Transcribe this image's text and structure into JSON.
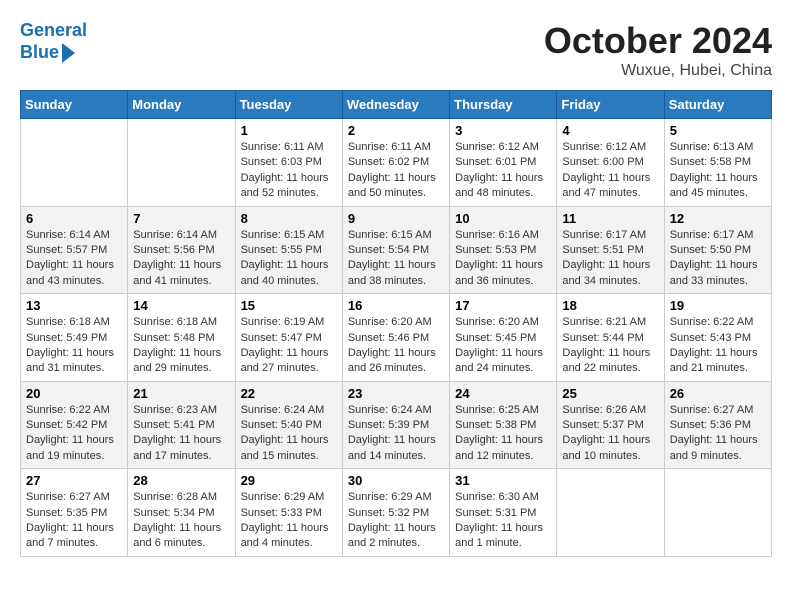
{
  "header": {
    "logo_line1": "General",
    "logo_line2": "Blue",
    "month": "October 2024",
    "location": "Wuxue, Hubei, China"
  },
  "weekdays": [
    "Sunday",
    "Monday",
    "Tuesday",
    "Wednesday",
    "Thursday",
    "Friday",
    "Saturday"
  ],
  "weeks": [
    [
      {
        "day": "",
        "info": ""
      },
      {
        "day": "",
        "info": ""
      },
      {
        "day": "1",
        "info": "Sunrise: 6:11 AM\nSunset: 6:03 PM\nDaylight: 11 hours and 52 minutes."
      },
      {
        "day": "2",
        "info": "Sunrise: 6:11 AM\nSunset: 6:02 PM\nDaylight: 11 hours and 50 minutes."
      },
      {
        "day": "3",
        "info": "Sunrise: 6:12 AM\nSunset: 6:01 PM\nDaylight: 11 hours and 48 minutes."
      },
      {
        "day": "4",
        "info": "Sunrise: 6:12 AM\nSunset: 6:00 PM\nDaylight: 11 hours and 47 minutes."
      },
      {
        "day": "5",
        "info": "Sunrise: 6:13 AM\nSunset: 5:58 PM\nDaylight: 11 hours and 45 minutes."
      }
    ],
    [
      {
        "day": "6",
        "info": "Sunrise: 6:14 AM\nSunset: 5:57 PM\nDaylight: 11 hours and 43 minutes."
      },
      {
        "day": "7",
        "info": "Sunrise: 6:14 AM\nSunset: 5:56 PM\nDaylight: 11 hours and 41 minutes."
      },
      {
        "day": "8",
        "info": "Sunrise: 6:15 AM\nSunset: 5:55 PM\nDaylight: 11 hours and 40 minutes."
      },
      {
        "day": "9",
        "info": "Sunrise: 6:15 AM\nSunset: 5:54 PM\nDaylight: 11 hours and 38 minutes."
      },
      {
        "day": "10",
        "info": "Sunrise: 6:16 AM\nSunset: 5:53 PM\nDaylight: 11 hours and 36 minutes."
      },
      {
        "day": "11",
        "info": "Sunrise: 6:17 AM\nSunset: 5:51 PM\nDaylight: 11 hours and 34 minutes."
      },
      {
        "day": "12",
        "info": "Sunrise: 6:17 AM\nSunset: 5:50 PM\nDaylight: 11 hours and 33 minutes."
      }
    ],
    [
      {
        "day": "13",
        "info": "Sunrise: 6:18 AM\nSunset: 5:49 PM\nDaylight: 11 hours and 31 minutes."
      },
      {
        "day": "14",
        "info": "Sunrise: 6:18 AM\nSunset: 5:48 PM\nDaylight: 11 hours and 29 minutes."
      },
      {
        "day": "15",
        "info": "Sunrise: 6:19 AM\nSunset: 5:47 PM\nDaylight: 11 hours and 27 minutes."
      },
      {
        "day": "16",
        "info": "Sunrise: 6:20 AM\nSunset: 5:46 PM\nDaylight: 11 hours and 26 minutes."
      },
      {
        "day": "17",
        "info": "Sunrise: 6:20 AM\nSunset: 5:45 PM\nDaylight: 11 hours and 24 minutes."
      },
      {
        "day": "18",
        "info": "Sunrise: 6:21 AM\nSunset: 5:44 PM\nDaylight: 11 hours and 22 minutes."
      },
      {
        "day": "19",
        "info": "Sunrise: 6:22 AM\nSunset: 5:43 PM\nDaylight: 11 hours and 21 minutes."
      }
    ],
    [
      {
        "day": "20",
        "info": "Sunrise: 6:22 AM\nSunset: 5:42 PM\nDaylight: 11 hours and 19 minutes."
      },
      {
        "day": "21",
        "info": "Sunrise: 6:23 AM\nSunset: 5:41 PM\nDaylight: 11 hours and 17 minutes."
      },
      {
        "day": "22",
        "info": "Sunrise: 6:24 AM\nSunset: 5:40 PM\nDaylight: 11 hours and 15 minutes."
      },
      {
        "day": "23",
        "info": "Sunrise: 6:24 AM\nSunset: 5:39 PM\nDaylight: 11 hours and 14 minutes."
      },
      {
        "day": "24",
        "info": "Sunrise: 6:25 AM\nSunset: 5:38 PM\nDaylight: 11 hours and 12 minutes."
      },
      {
        "day": "25",
        "info": "Sunrise: 6:26 AM\nSunset: 5:37 PM\nDaylight: 11 hours and 10 minutes."
      },
      {
        "day": "26",
        "info": "Sunrise: 6:27 AM\nSunset: 5:36 PM\nDaylight: 11 hours and 9 minutes."
      }
    ],
    [
      {
        "day": "27",
        "info": "Sunrise: 6:27 AM\nSunset: 5:35 PM\nDaylight: 11 hours and 7 minutes."
      },
      {
        "day": "28",
        "info": "Sunrise: 6:28 AM\nSunset: 5:34 PM\nDaylight: 11 hours and 6 minutes."
      },
      {
        "day": "29",
        "info": "Sunrise: 6:29 AM\nSunset: 5:33 PM\nDaylight: 11 hours and 4 minutes."
      },
      {
        "day": "30",
        "info": "Sunrise: 6:29 AM\nSunset: 5:32 PM\nDaylight: 11 hours and 2 minutes."
      },
      {
        "day": "31",
        "info": "Sunrise: 6:30 AM\nSunset: 5:31 PM\nDaylight: 11 hours and 1 minute."
      },
      {
        "day": "",
        "info": ""
      },
      {
        "day": "",
        "info": ""
      }
    ]
  ]
}
